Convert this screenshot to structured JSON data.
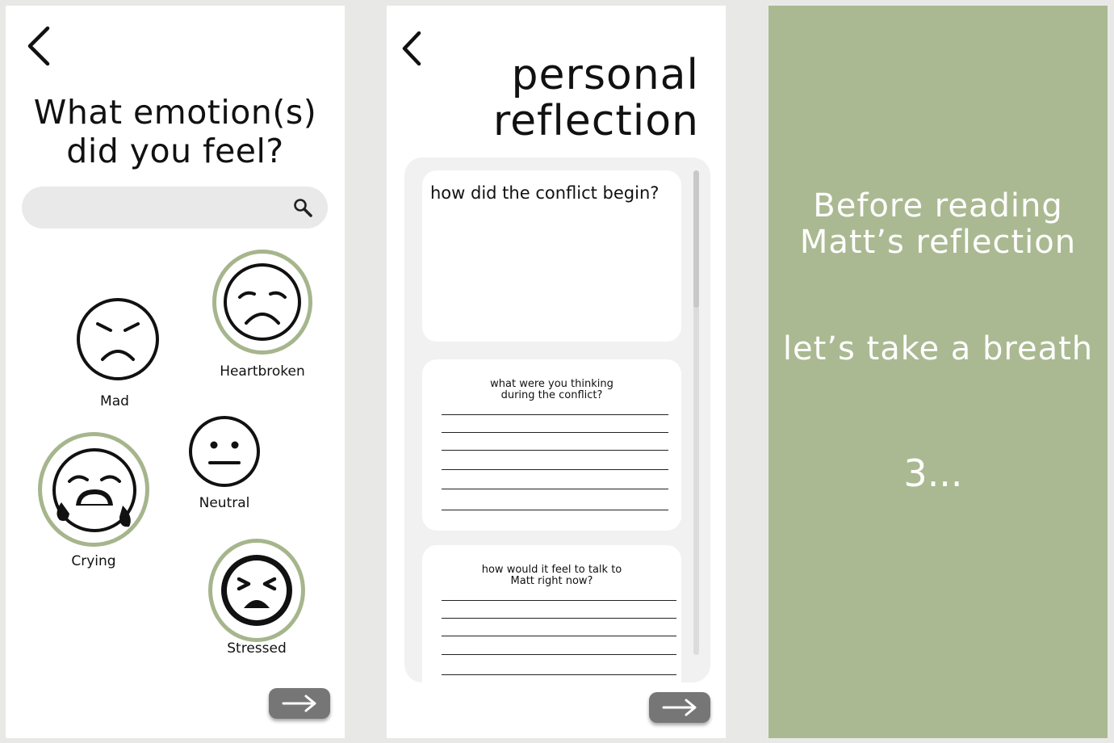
{
  "screen1": {
    "title_line1": "What emotion(s)",
    "title_line2": "did you feel?",
    "search_placeholder": "",
    "emotions": [
      {
        "label": "Mad",
        "icon": "angry-face-icon",
        "selected": false
      },
      {
        "label": "Heartbroken",
        "icon": "sad-face-icon",
        "selected": true
      },
      {
        "label": "Neutral",
        "icon": "neutral-face-icon",
        "selected": false
      },
      {
        "label": "Crying",
        "icon": "crying-face-icon",
        "selected": true
      },
      {
        "label": "Stressed",
        "icon": "stressed-face-icon",
        "selected": true
      }
    ]
  },
  "screen2": {
    "title_line1": "personal",
    "title_line2": "reflection",
    "questions": [
      {
        "line1": "how did the conflict begin?",
        "line2": ""
      },
      {
        "line1": "what were you thinking",
        "line2": "during the conflict?"
      },
      {
        "line1": "how would it feel to talk to",
        "line2": "Matt right now?"
      }
    ]
  },
  "screen3": {
    "heading_line1": "Before reading",
    "heading_line2": "Matt’s reflection",
    "subheading": "let’s take a breath",
    "countdown": "3..."
  },
  "colors": {
    "accent_green": "#aab991",
    "ring_green": "#a6b58c",
    "button_gray": "#767676",
    "panel_gray": "#f1f1f1"
  }
}
